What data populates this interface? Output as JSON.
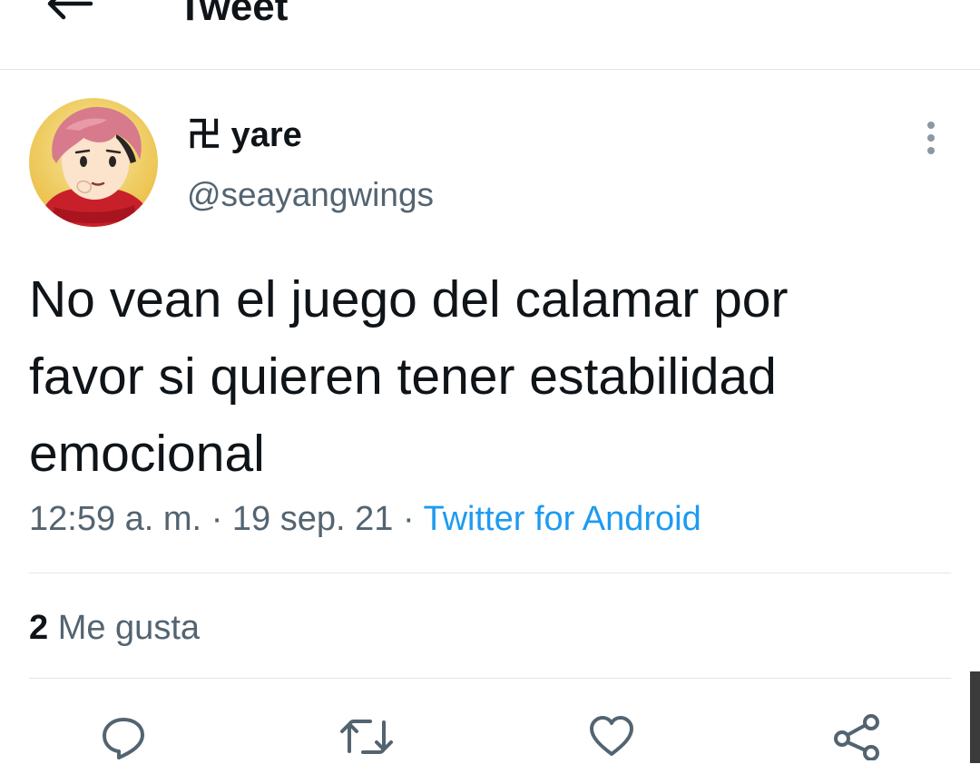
{
  "header": {
    "title": "Tweet",
    "back_icon": "arrow-left-icon"
  },
  "author": {
    "display_name": "卍 yare",
    "handle": "@seayangwings",
    "avatar_icon": "anime-avatar"
  },
  "tweet": {
    "line1": "No vean el juego del calamar por",
    "line2": "favor si quieren tener estabilidad",
    "line3": "emocional"
  },
  "meta": {
    "time": "12:59 a. m.",
    "separator": "·",
    "date": "19 sep. 21",
    "source": "Twitter for Android"
  },
  "stats": {
    "likes_count": "2",
    "likes_label": "Me gusta"
  },
  "actions": {
    "reply_icon": "reply-icon",
    "retweet_icon": "retweet-icon",
    "like_icon": "heart-icon",
    "share_icon": "share-icon"
  },
  "colors": {
    "link": "#1d9bf0",
    "secondary_text": "#536471",
    "primary_text": "#0f1419",
    "divider": "#e1e5e8"
  }
}
